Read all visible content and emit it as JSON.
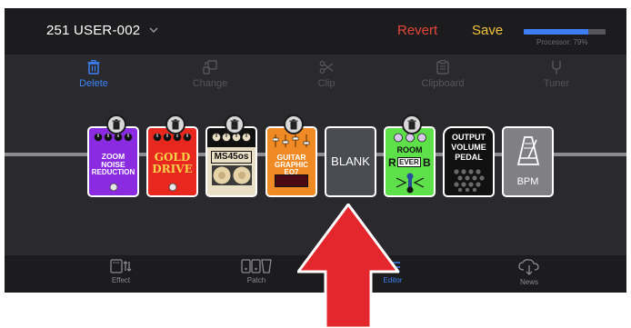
{
  "header": {
    "patch_name": "251 USER-002",
    "revert_label": "Revert",
    "save_label": "Save",
    "processor_label": "Processor: 79%",
    "processor_usage": 0.79
  },
  "toolbar": {
    "items": [
      {
        "label": "Delete",
        "icon": "trash-icon",
        "active": true
      },
      {
        "label": "Change",
        "icon": "change-icon",
        "active": false
      },
      {
        "label": "Clip",
        "icon": "scissors-icon",
        "active": false
      },
      {
        "label": "Clipboard",
        "icon": "clipboard-icon",
        "active": false
      },
      {
        "label": "Tuner",
        "icon": "tuner-icon",
        "active": false
      }
    ]
  },
  "pedals": [
    {
      "name_lines": [
        "ZOOM",
        "NOISE",
        "REDUCTION"
      ],
      "color": "#8a2be2",
      "deletable": true
    },
    {
      "name_lines": [
        "GOLD",
        "DRIVE"
      ],
      "color": "#e8281e",
      "deletable": true
    },
    {
      "name_lines": [
        "MS45os"
      ],
      "color": "#e9dfc4",
      "deletable": true
    },
    {
      "name_lines": [
        "GUITAR",
        "GRAPHIC EQ7"
      ],
      "color": "#f08a24",
      "deletable": true
    },
    {
      "name_lines": [
        "BLANK"
      ],
      "color": "#4a4c52",
      "deletable": false
    },
    {
      "name_lines": [
        "ROOM",
        "R",
        "EVER",
        "B"
      ],
      "color": "#5de04a",
      "deletable": true
    },
    {
      "name_lines": [
        "OUTPUT",
        "VOLUME",
        "PEDAL"
      ],
      "color": "#111111",
      "deletable": false
    },
    {
      "name_lines": [
        "BPM"
      ],
      "color": "#7f7f84",
      "deletable": false
    }
  ],
  "tabs": [
    {
      "label": "Effect",
      "icon": "effect-icon",
      "active": false
    },
    {
      "label": "Patch",
      "icon": "patch-icon",
      "active": false
    },
    {
      "label": "Editor",
      "icon": "editor-icon",
      "active": true
    },
    {
      "label": "News",
      "icon": "cloud-download-icon",
      "active": false
    }
  ],
  "annotation": {
    "icon": "red-arrow-up-icon",
    "color": "#e3272d"
  }
}
